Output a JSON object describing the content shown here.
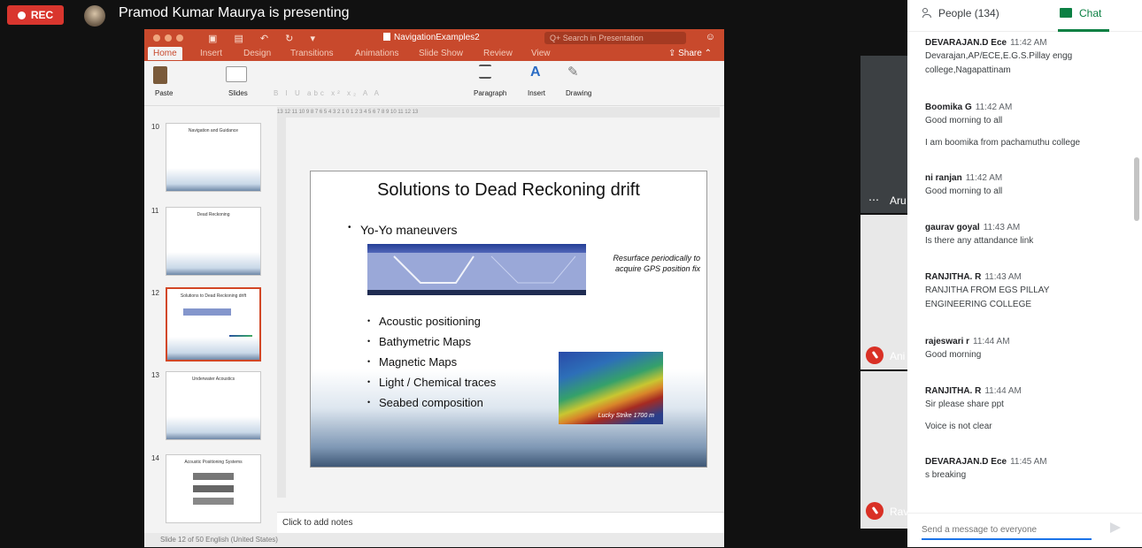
{
  "meet": {
    "rec_label": "REC",
    "presenter_text": "Pramod Kumar Maurya is presenting",
    "tiles": [
      {
        "label": "Aru"
      },
      {
        "label": "Ani"
      },
      {
        "label": "Rav"
      }
    ]
  },
  "ppt": {
    "doc_title": "NavigationExamples2",
    "search_placeholder": "Q+ Search in Presentation",
    "tabs": [
      "Home",
      "Insert",
      "Design",
      "Transitions",
      "Animations",
      "Slide Show",
      "Review",
      "View"
    ],
    "share_label": "Share",
    "ribbon": {
      "paste": "Paste",
      "slides": "Slides",
      "paragraph": "Paragraph",
      "insert": "Insert",
      "drawing": "Drawing"
    },
    "ruler_text": "13 12 11 10 9 8 7 6 5 4 3 2 1 0 1 2 3 4 5 6 7 8 9 10 11 12 13",
    "thumbnails": [
      {
        "num": "10",
        "title": "Navigation and Guidance"
      },
      {
        "num": "11",
        "title": "Dead Reckoning"
      },
      {
        "num": "12",
        "title": "Solutions to Dead Reckoning drift"
      },
      {
        "num": "13",
        "title": "Underwater Acoustics"
      },
      {
        "num": "14",
        "title": "Acoustic Positioning Systems"
      }
    ],
    "slide": {
      "title": "Solutions to Dead Reckoning drift",
      "main_bullet": "Yo-Yo maneuvers",
      "resurface_caption": "Resurface periodically to acquire GPS position fix",
      "sub_bullets": [
        "Acoustic positioning",
        "Bathymetric Maps",
        "Magnetic Maps",
        "Light / Chemical traces",
        "Seabed composition"
      ],
      "image_caption": "Lucky Strike 1700 m"
    },
    "notes_placeholder": "Click to add notes",
    "status_text": "Slide 12 of 50    English (United States)"
  },
  "panel": {
    "people_label": "People (134)",
    "chat_label": "Chat",
    "messages": [
      {
        "author": "DEVARAJAN.D Ece",
        "time": "11:42 AM",
        "lines": [
          "Devarajan,AP/ECE,E.G.S.Pillay engg college,Nagapattinam"
        ]
      },
      {
        "author": "Boomika G",
        "time": "11:42 AM",
        "lines": [
          "Good morning to all",
          "I am boomika from pachamuthu college"
        ]
      },
      {
        "author": "ni ranjan",
        "time": "11:42 AM",
        "lines": [
          "Good morning to all"
        ]
      },
      {
        "author": "gaurav goyal",
        "time": "11:43 AM",
        "lines": [
          "Is there any attandance link"
        ]
      },
      {
        "author": "RANJITHA. R",
        "time": "11:43 AM",
        "lines": [
          "RANJITHA FROM EGS PILLAY ENGINEERING COLLEGE"
        ]
      },
      {
        "author": "rajeswari r",
        "time": "11:44 AM",
        "lines": [
          "Good morning"
        ]
      },
      {
        "author": "RANJITHA. R",
        "time": "11:44 AM",
        "lines": [
          "Sir please share ppt",
          "Voice is not clear"
        ]
      },
      {
        "author": "DEVARAJAN.D Ece",
        "time": "11:45 AM",
        "lines": [
          "s breaking"
        ]
      }
    ],
    "compose_placeholder": "Send a message to everyone"
  }
}
